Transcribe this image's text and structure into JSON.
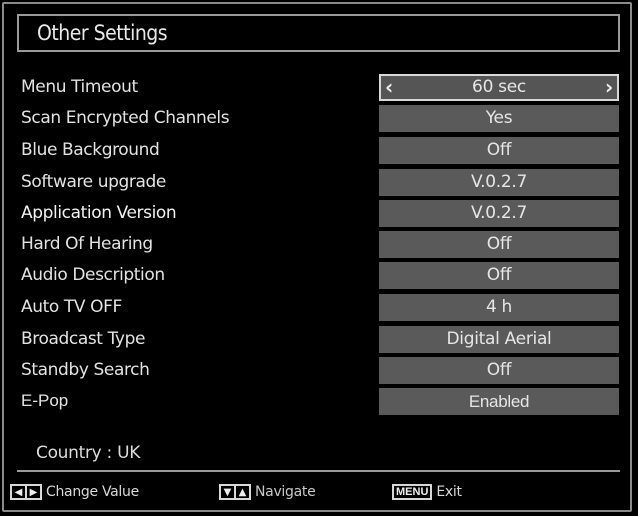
{
  "title": "Other Settings",
  "settings": [
    {
      "label": "Menu Timeout",
      "value": "60 sec",
      "selected": true
    },
    {
      "label": "Scan Encrypted Channels",
      "value": "Yes"
    },
    {
      "label": "Blue Background",
      "value": "Off"
    },
    {
      "label": "Software upgrade",
      "value": "V.0.2.7"
    },
    {
      "label": "Application Version",
      "value": "V.0.2.7"
    },
    {
      "label": "Hard Of Hearing",
      "value": "Off"
    },
    {
      "label": "Audio Description",
      "value": "Off"
    },
    {
      "label": "Auto TV OFF",
      "value": "4 h"
    },
    {
      "label": "Broadcast Type",
      "value": "Digital Aerial"
    },
    {
      "label": "Standby Search",
      "value": "Off"
    },
    {
      "label": "E-Pop",
      "value": "Enabled"
    }
  ],
  "country": "Country : UK",
  "footer": {
    "change_value": "Change Value",
    "navigate": "Navigate",
    "menu_key": "MENU",
    "exit": "Exit"
  },
  "icons": {
    "left_arrow": "‹",
    "right_arrow": "›",
    "tri_left": "◀",
    "tri_right": "▶",
    "tri_down": "▼",
    "tri_up": "▲"
  }
}
